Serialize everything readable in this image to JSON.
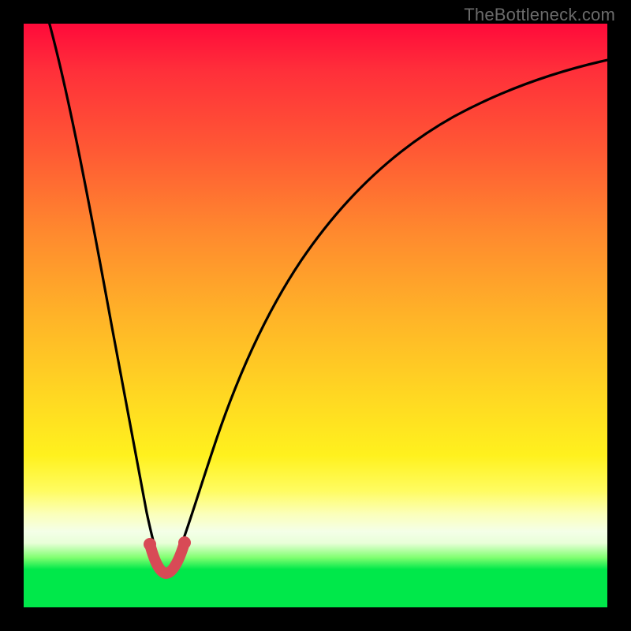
{
  "watermark": "TheBottleneck.com",
  "colors": {
    "frame": "#000000",
    "curve": "#000000",
    "marker": "#d84a56",
    "gradient_stops": [
      "#ff0a3a",
      "#ff5a34",
      "#ffb328",
      "#fff11e",
      "#f4ffe8",
      "#00e84a"
    ]
  },
  "chart_data": {
    "type": "line",
    "title": "",
    "xlabel": "",
    "ylabel": "",
    "xlim": [
      0,
      100
    ],
    "ylim": [
      0,
      100
    ],
    "grid": false,
    "legend": false,
    "notes": "Background vertical gradient maps y=100 (top, worst/red) to y≈6 (green band) to y=0. A V-shaped black curve dips to ~0 near x≈23 with a short highlighted segment at the trough.",
    "x": [
      5,
      8,
      11,
      14,
      17,
      19,
      20.5,
      22,
      23,
      24,
      25.5,
      27,
      29,
      32,
      36,
      41,
      47,
      54,
      62,
      71,
      81,
      92,
      100
    ],
    "series": [
      {
        "name": "curve",
        "values": [
          100,
          86,
          72,
          58,
          43,
          29,
          18,
          8,
          2,
          3,
          10,
          20,
          32,
          45,
          56,
          65,
          72,
          77,
          81,
          84,
          86.5,
          88.5,
          90
        ]
      }
    ],
    "highlight_segment": {
      "x": [
        20.5,
        22,
        23,
        24,
        25.5
      ],
      "y": [
        12,
        5,
        1.5,
        2.5,
        9
      ]
    }
  }
}
